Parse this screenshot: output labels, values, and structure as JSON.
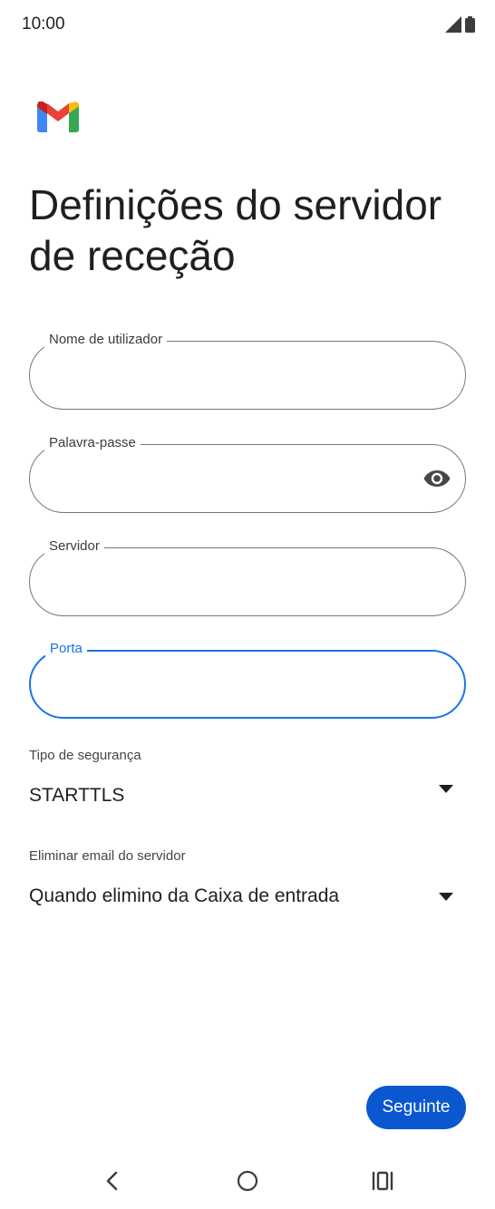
{
  "status_bar": {
    "time": "10:00",
    "icons": [
      "signal-icon",
      "battery-icon"
    ]
  },
  "header": {
    "logo": "gmail-logo",
    "title": "Definições do servidor de receção"
  },
  "form": {
    "username": {
      "label": "Nome de utilizador",
      "value": ""
    },
    "password": {
      "label": "Palavra-passe",
      "value": "",
      "icon": "eye-icon"
    },
    "server": {
      "label": "Servidor",
      "value": ""
    },
    "port": {
      "label": "Porta",
      "value": "",
      "focused": true
    }
  },
  "security_type": {
    "label": "Tipo de segurança",
    "value": "STARTTLS",
    "icon": "dropdown-icon"
  },
  "delete_email": {
    "label": "Eliminar email do servidor",
    "value": "Quando elimino da Caixa de entrada",
    "icon": "dropdown-icon"
  },
  "actions": {
    "next_label": "Seguinte"
  },
  "navigation": {
    "icons": [
      "back-icon",
      "home-icon",
      "recents-icon"
    ]
  },
  "colors": {
    "accent": "#0b57d0",
    "focus": "#1a73e8",
    "outline": "#747775"
  }
}
